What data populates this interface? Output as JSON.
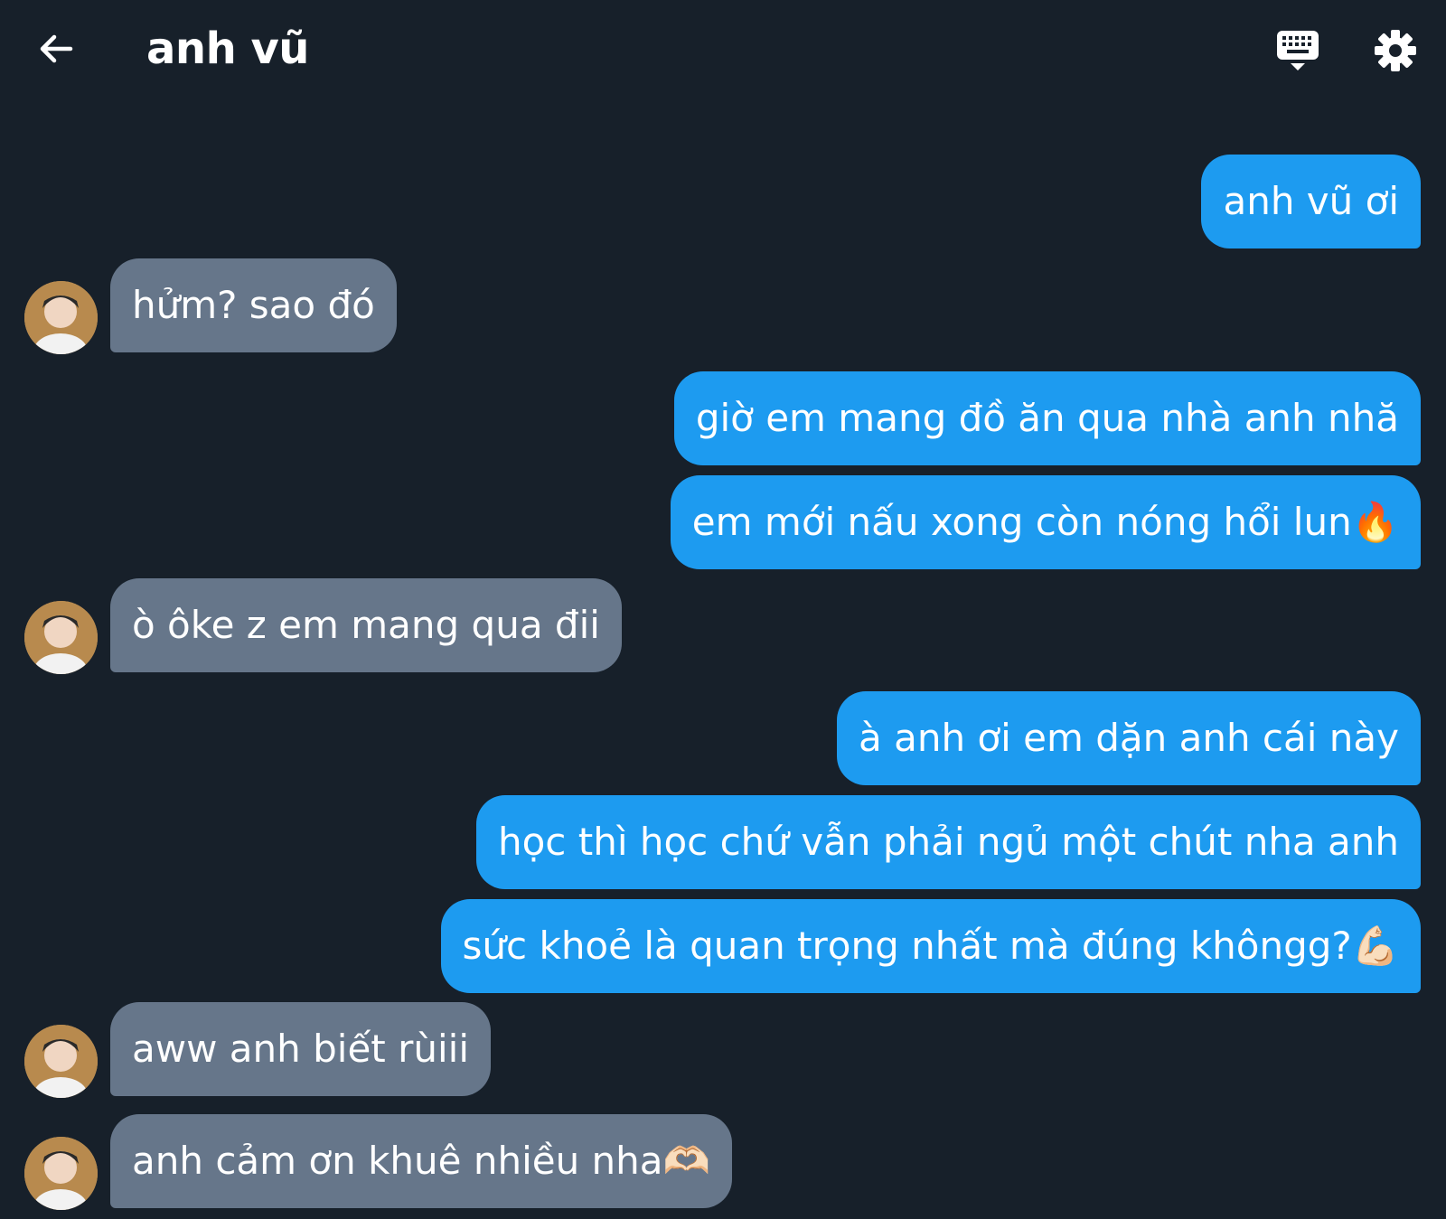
{
  "header": {
    "title": "anh vũ",
    "back_icon": "arrow-left-icon",
    "keyboard_icon": "keyboard-icon",
    "settings_icon": "gear-icon"
  },
  "colors": {
    "background": "#17202a",
    "sent_bubble": "#1d9bf0",
    "received_bubble": "#66768a",
    "text": "#ffffff"
  },
  "messages": [
    {
      "from": "me",
      "text": "anh vũ ơi"
    },
    {
      "from": "them",
      "text": "hửm? sao đó"
    },
    {
      "from": "me",
      "text": "giờ em mang đồ ăn qua nhà anh nhă"
    },
    {
      "from": "me",
      "text": "em mới nấu xong còn nóng hổi lun🔥"
    },
    {
      "from": "them",
      "text": "ò ôke z em mang qua đii"
    },
    {
      "from": "me",
      "text": "à anh ơi em dặn anh cái này"
    },
    {
      "from": "me",
      "text": "học thì học chứ vẫn phải ngủ một chút nha anh"
    },
    {
      "from": "me",
      "text": "sức khoẻ là quan trọng nhất mà đúng khôngg?💪🏻"
    },
    {
      "from": "them",
      "text": "aww anh biết rùiii"
    },
    {
      "from": "them",
      "text": "anh cảm ơn khuê nhiều nha🫶🏻"
    }
  ]
}
